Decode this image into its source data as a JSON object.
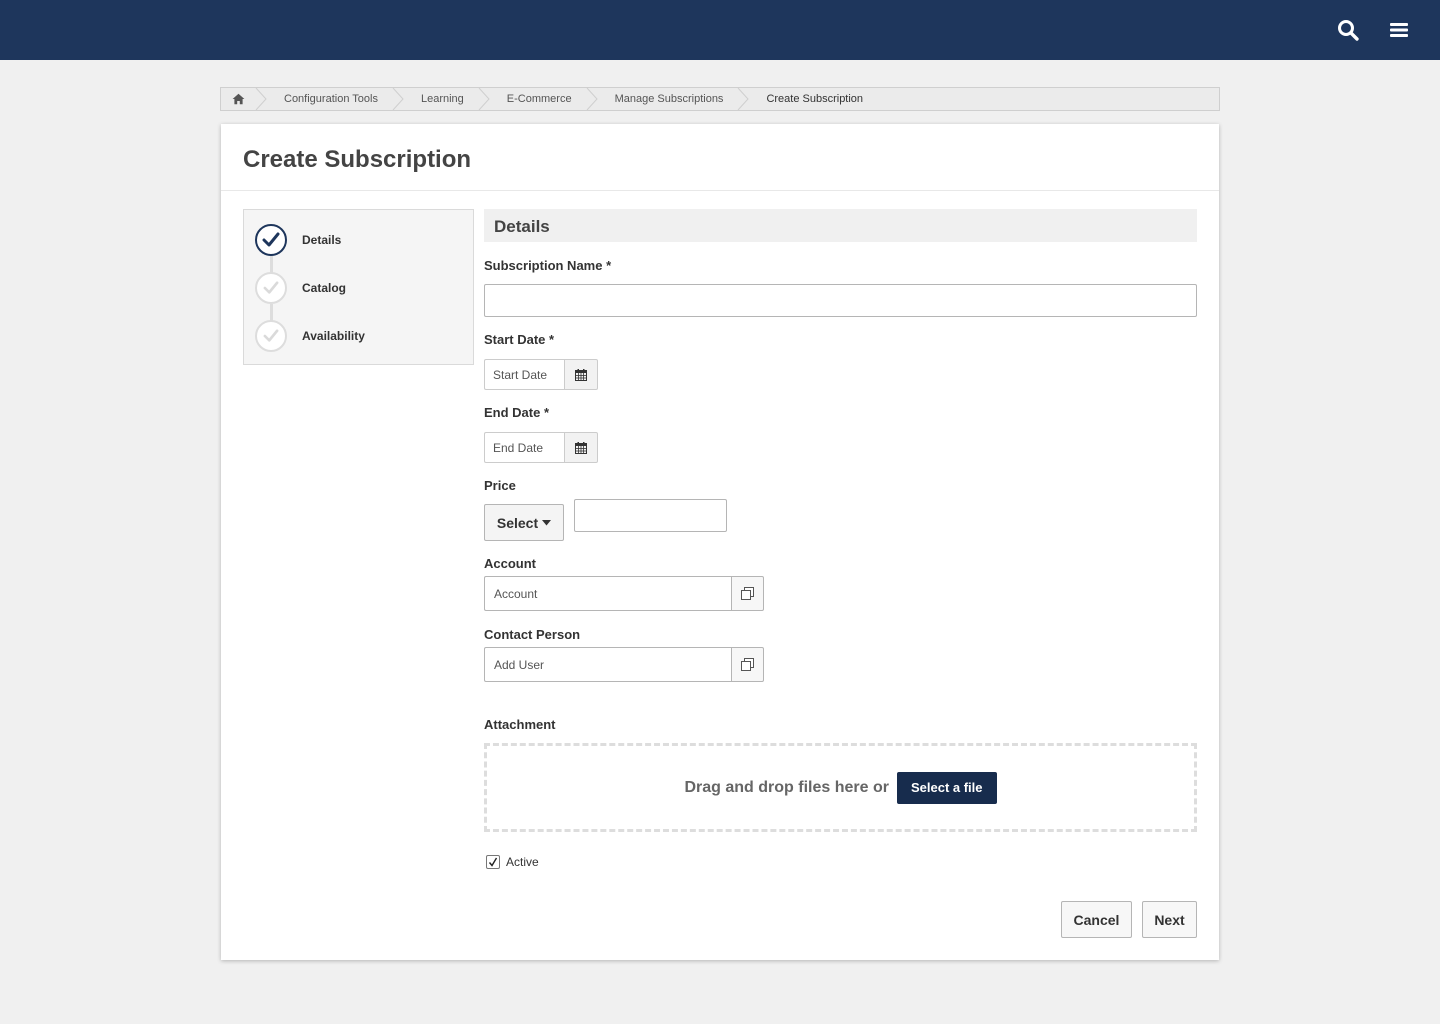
{
  "topbar": {
    "search_icon": "search-icon",
    "menu_icon": "hamburger-menu-icon",
    "background_color": "#1e365c"
  },
  "breadcrumb": {
    "home_icon": "home-icon",
    "items": [
      "Configuration Tools",
      "Learning",
      "E-Commerce",
      "Manage Subscriptions",
      "Create Subscription"
    ]
  },
  "page": {
    "title": "Create Subscription"
  },
  "stepper": {
    "steps": [
      {
        "label": "Details",
        "state": "active"
      },
      {
        "label": "Catalog",
        "state": "pending"
      },
      {
        "label": "Availability",
        "state": "pending"
      }
    ]
  },
  "form": {
    "section_title": "Details",
    "subscription_name": {
      "label": "Subscription Name *",
      "value": ""
    },
    "start_date": {
      "label": "Start Date *",
      "placeholder": "Start Date",
      "icon": "calendar-icon"
    },
    "end_date": {
      "label": "End Date *",
      "placeholder": "End Date",
      "icon": "calendar-icon"
    },
    "price": {
      "label": "Price",
      "select_label": "Select",
      "value": ""
    },
    "account": {
      "label": "Account",
      "placeholder": "Account",
      "icon": "lookup-icon"
    },
    "contact_person": {
      "label": "Contact Person",
      "placeholder": "Add User",
      "icon": "lookup-icon"
    },
    "attachment": {
      "label": "Attachment",
      "drop_text": "Drag and drop files here or",
      "button_label": "Select a file"
    },
    "active": {
      "label": "Active",
      "checked": true
    }
  },
  "actions": {
    "cancel_label": "Cancel",
    "next_label": "Next"
  },
  "colors": {
    "brand_navy": "#1e365c",
    "button_navy": "#172c4d"
  }
}
